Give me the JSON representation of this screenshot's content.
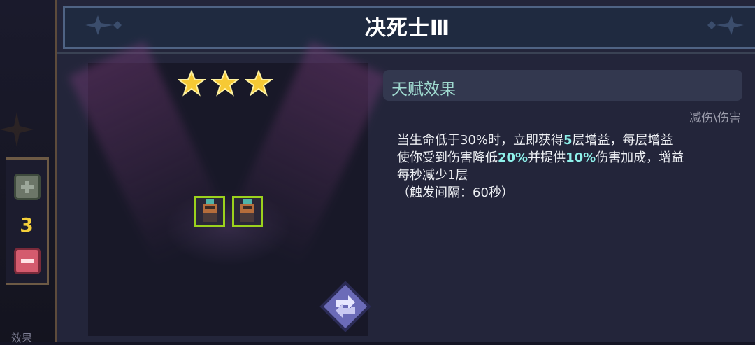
{
  "dialog": {
    "title": "决死士Ⅲ"
  },
  "side": {
    "count": "3",
    "bottom_tab": "效果"
  },
  "stars": 3,
  "talent": {
    "header": "天赋效果",
    "tag": "减伤\\伤害",
    "desc": {
      "l1a": "当生命低于30%时，立即获得",
      "l1b": "5",
      "l1c": "层增益，每层增益",
      "l2a": "使你受到伤害降低",
      "l2b": "20%",
      "l2c": "并提供",
      "l2d": "10%",
      "l2e": "伤害加成，增益",
      "l3": "每秒减少1层",
      "l4": "（触发间隔：60秒）"
    }
  },
  "colors": {
    "accent_cyan": "#8ef0ea",
    "count_yellow": "#f4cf3a",
    "selection_green": "#9bd21d",
    "minus_red": "#d45b6e"
  },
  "icons": [
    "plus-icon",
    "minus-icon",
    "star-icon",
    "refresh-icon"
  ]
}
